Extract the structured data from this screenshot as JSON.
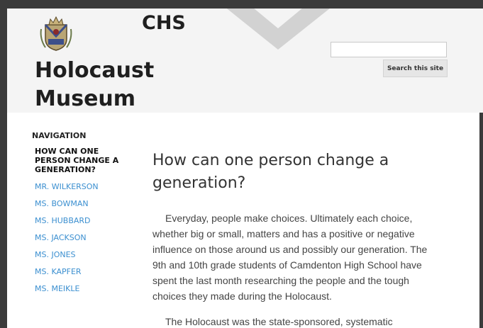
{
  "site": {
    "title_line1": "CHS",
    "title_line2": "Holocaust Museum"
  },
  "search": {
    "input_value": "",
    "button_label": "Search this site"
  },
  "nav": {
    "heading": "NAVIGATION",
    "items": [
      {
        "label": "HOW CAN ONE PERSON CHANGE A GENERATION?"
      },
      {
        "label": "MR. WILKERSON"
      },
      {
        "label": "MS. BOWMAN"
      },
      {
        "label": "MS. HUBBARD"
      },
      {
        "label": "MS. JACKSON"
      },
      {
        "label": "MS. JONES"
      },
      {
        "label": "MS. KAPFER"
      },
      {
        "label": "MS. MEIKLE"
      }
    ]
  },
  "page": {
    "title": "How can one person change a generation?",
    "paragraphs": [
      "Everyday, people make choices.  Ultimately each choice, whether big or small, matters and has a positive or negative influence on those around us and possibly our generation. The 9th and 10th grade students of Camdenton High School have spent the last month researching the people and the tough choices they made during the Holocaust.",
      "The Holocaust was the state-sponsored, systematic"
    ]
  },
  "colors": {
    "nav_link": "#3b8fd0",
    "background": "#3b3b3b",
    "header_bg": "#f4f4f4"
  }
}
